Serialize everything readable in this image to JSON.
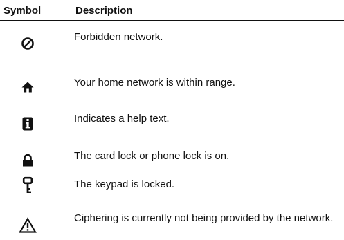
{
  "table": {
    "headers": {
      "symbol": "Symbol",
      "description": "Description"
    },
    "rows": [
      {
        "icon": "forbidden-network-icon",
        "description": "Forbidden network."
      },
      {
        "icon": "home-network-icon",
        "description": "Your home network is within range."
      },
      {
        "icon": "help-info-icon",
        "description": "Indicates a help text."
      },
      {
        "icon": "padlock-icon",
        "description": "The card lock or phone lock is on."
      },
      {
        "icon": "key-icon",
        "description": "The keypad is locked."
      },
      {
        "icon": "warning-triangle-icon",
        "description": "Ciphering is currently not being provided by the network."
      }
    ]
  }
}
